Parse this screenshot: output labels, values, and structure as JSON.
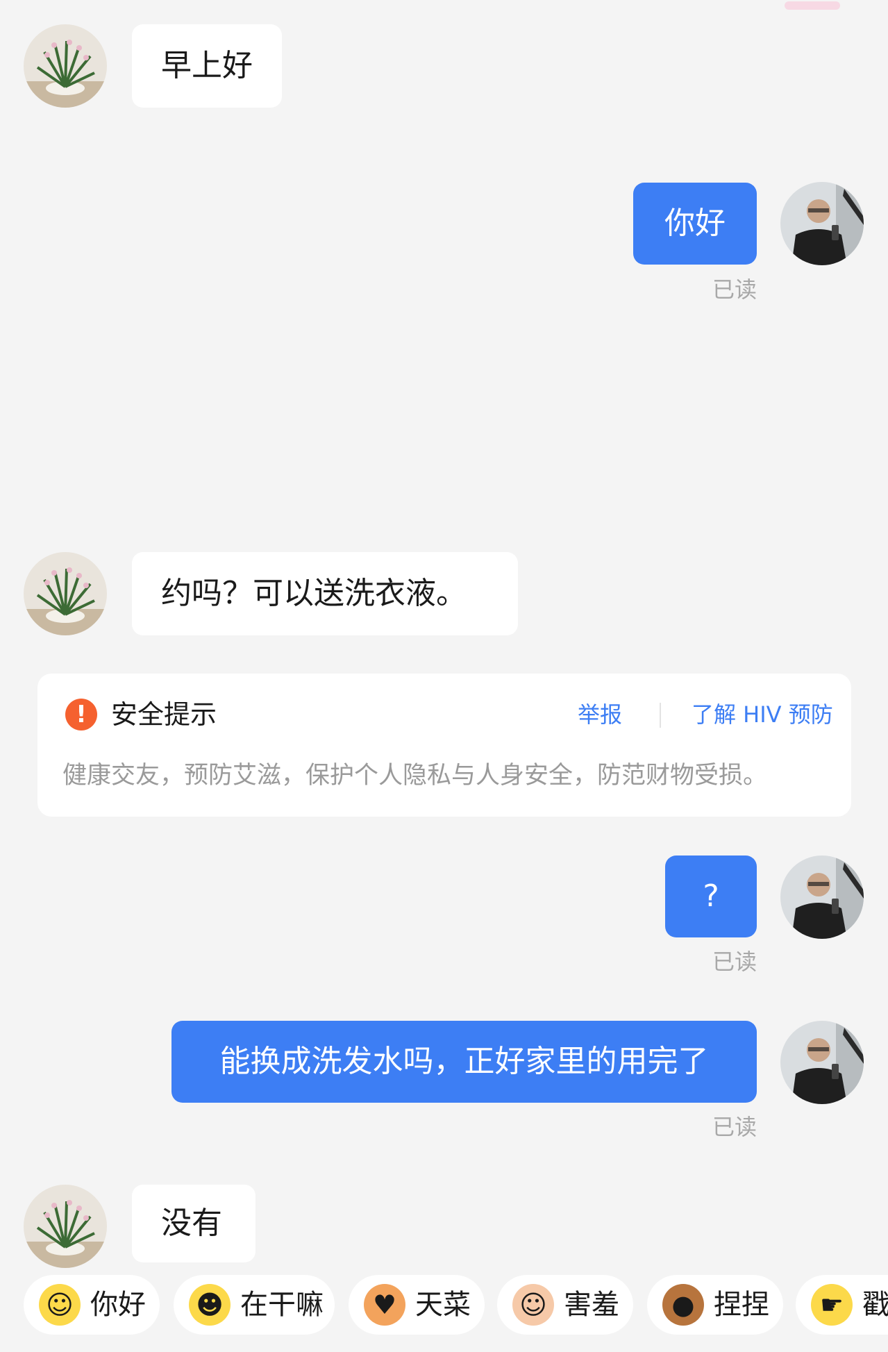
{
  "messages": [
    {
      "side": "in",
      "text": "早上好"
    },
    {
      "side": "out",
      "text": "你好",
      "status": "已读"
    },
    {
      "side": "in",
      "text": "约吗？可以送洗衣液。"
    },
    {
      "side": "out",
      "text": "?",
      "status": "已读"
    },
    {
      "side": "out",
      "text": "能换成洗发水吗，正好家里的用完了",
      "status": "已读"
    },
    {
      "side": "in",
      "text": "没有"
    }
  ],
  "safety": {
    "title": "安全提示",
    "report": "举报",
    "hiv_link": "了解 HIV 预防",
    "body": "健康交友，预防艾滋，保护个人隐私与人身安全，防范财物受损。"
  },
  "quick_replies": [
    {
      "label": "你好",
      "icon": "hi-emoji-icon"
    },
    {
      "label": "在干嘛",
      "icon": "peek-emoji-icon"
    },
    {
      "label": "天菜",
      "icon": "dog-emoji-icon"
    },
    {
      "label": "害羞",
      "icon": "shy-emoji-icon"
    },
    {
      "label": "捏捏",
      "icon": "bear-emoji-icon"
    },
    {
      "label": "戳",
      "icon": "point-emoji-icon"
    }
  ],
  "colors": {
    "background": "#f4f4f4",
    "outgoing_bubble": "#3d7ef4",
    "incoming_bubble": "#ffffff",
    "link": "#3d7ef4",
    "warning": "#f5612f",
    "read_status": "#a8a8a8"
  }
}
